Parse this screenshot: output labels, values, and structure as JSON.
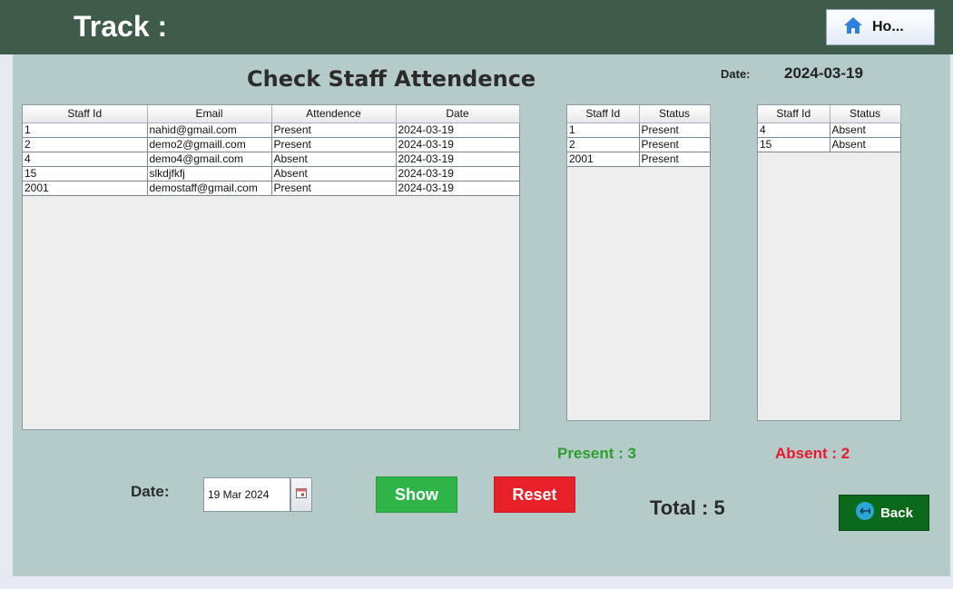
{
  "app": {
    "title": "Track :",
    "home_label": "Ho..."
  },
  "page": {
    "heading": "Check Staff Attendence",
    "date_label": "Date:",
    "date_value": "2024-03-19"
  },
  "main_table": {
    "columns": [
      "Staff Id",
      "Email",
      "Attendence",
      "Date"
    ],
    "rows": [
      [
        "1",
        "nahid@gmail.com",
        "Present",
        "2024-03-19"
      ],
      [
        "2",
        "demo2@gmaill.com",
        "Present",
        "2024-03-19"
      ],
      [
        "4",
        "demo4@gmail.com",
        "Absent",
        "2024-03-19"
      ],
      [
        "15",
        "slkdjfkfj",
        "Absent",
        "2024-03-19"
      ],
      [
        "2001",
        "demostaff@gmail.com",
        "Present",
        "2024-03-19"
      ]
    ]
  },
  "present_table": {
    "columns": [
      "Staff Id",
      "Status"
    ],
    "rows": [
      [
        "1",
        "Present"
      ],
      [
        "2",
        "Present"
      ],
      [
        "2001",
        "Present"
      ]
    ]
  },
  "absent_table": {
    "columns": [
      "Staff Id",
      "Status"
    ],
    "rows": [
      [
        "4",
        "Absent"
      ],
      [
        "15",
        "Absent"
      ]
    ]
  },
  "summary": {
    "present": "Present : 3",
    "absent": "Absent : 2",
    "total": "Total : 5"
  },
  "controls": {
    "date_label": "Date:",
    "date_value": "19 Mar 2024",
    "show_label": "Show",
    "reset_label": "Reset",
    "back_label": "Back"
  },
  "colors": {
    "header_bg": "#3e5c49",
    "panel_bg": "#b4cbca",
    "present": "#2ca02c",
    "absent": "#e8192c",
    "show_btn": "#2fb44a",
    "reset_btn": "#e8202a",
    "back_btn": "#0b6a1a"
  },
  "icons": {
    "home": "home-icon",
    "calendar": "calendar-icon",
    "back": "back-arrow-icon"
  }
}
